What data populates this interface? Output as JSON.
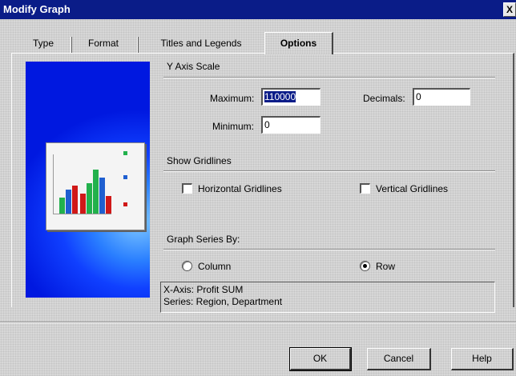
{
  "window": {
    "title": "Modify Graph",
    "close_label": "X"
  },
  "tabs": [
    "Type",
    "Format",
    "Titles and Legends",
    "Options"
  ],
  "y_axis_scale": {
    "group_label": "Y Axis Scale",
    "maximum_label": "Maximum:",
    "maximum_value": "110000",
    "minimum_label": "Minimum:",
    "minimum_value": "0",
    "decimals_label": "Decimals:",
    "decimals_value": "0"
  },
  "gridlines": {
    "group_label": "Show Gridlines",
    "horizontal_label": "Horizontal Gridlines",
    "horizontal_checked": false,
    "vertical_label": "Vertical Gridlines",
    "vertical_checked": false
  },
  "series_by": {
    "group_label": "Graph Series By:",
    "column_label": "Column",
    "row_label": "Row",
    "selected": "Row"
  },
  "info": {
    "line1": "X-Axis: Profit SUM",
    "line2": "Series: Region, Department"
  },
  "buttons": {
    "ok": "OK",
    "cancel": "Cancel",
    "help": "Help"
  },
  "colors": {
    "titlebar": "#0a1c88",
    "preview_blue": "#1040ff"
  }
}
